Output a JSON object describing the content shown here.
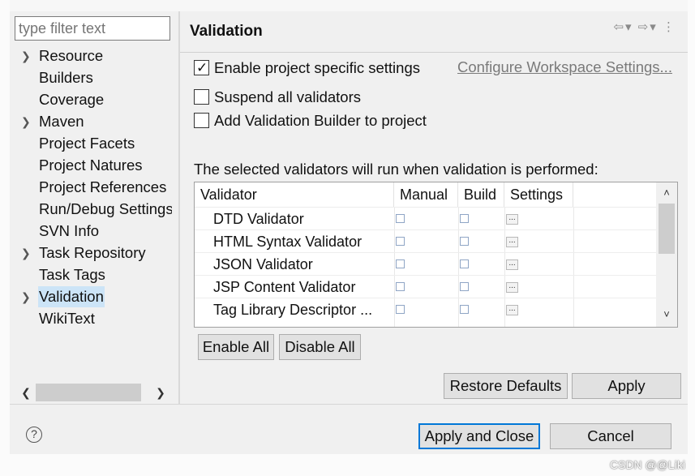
{
  "filter": {
    "placeholder": "type filter text"
  },
  "tree": [
    {
      "label": "Resource",
      "expandable": true
    },
    {
      "label": "Builders",
      "expandable": false
    },
    {
      "label": "Coverage",
      "expandable": false
    },
    {
      "label": "Maven",
      "expandable": true
    },
    {
      "label": "Project Facets",
      "expandable": false
    },
    {
      "label": "Project Natures",
      "expandable": false
    },
    {
      "label": "Project References",
      "expandable": false
    },
    {
      "label": "Run/Debug Settings",
      "expandable": false
    },
    {
      "label": "SVN Info",
      "expandable": false
    },
    {
      "label": "Task Repository",
      "expandable": true
    },
    {
      "label": "Task Tags",
      "expandable": false
    },
    {
      "label": "Validation",
      "expandable": true,
      "selected": true
    },
    {
      "label": "WikiText",
      "expandable": false
    }
  ],
  "page": {
    "title": "Validation",
    "enable_specific": {
      "label": "Enable project specific settings",
      "checked": true
    },
    "configure_link": "Configure Workspace Settings...",
    "suspend": {
      "label": "Suspend all validators",
      "checked": false
    },
    "add_builder": {
      "label": "Add Validation Builder to project",
      "checked": false
    },
    "selected_label": "The selected validators will run when validation is performed:",
    "table": {
      "headers": {
        "validator": "Validator",
        "manual": "Manual",
        "build": "Build",
        "settings": "Settings"
      },
      "rows": [
        {
          "name": "DTD Validator",
          "manual": false,
          "build": false
        },
        {
          "name": "HTML Syntax Validator",
          "manual": false,
          "build": false
        },
        {
          "name": "JSON Validator",
          "manual": false,
          "build": false
        },
        {
          "name": "JSP Content Validator",
          "manual": false,
          "build": false
        },
        {
          "name": "Tag Library Descriptor ...",
          "manual": false,
          "build": false
        }
      ],
      "settings_glyph": "..."
    },
    "enable_all": "Enable All",
    "disable_all": "Disable All",
    "restore_defaults": "Restore Defaults",
    "apply": "Apply"
  },
  "footer": {
    "help": "?",
    "apply_close": "Apply and Close",
    "cancel": "Cancel"
  },
  "watermark": "CSDN @@Liki",
  "colors": {
    "selection": "#cce4f7",
    "default_button_border": "#0078d7",
    "link": "#7a7a7a"
  },
  "icons": [
    "expand-arrow-icon",
    "back-arrow-icon",
    "forward-arrow-icon",
    "view-menu-icon",
    "scroll-up-icon",
    "scroll-down-icon",
    "scroll-left-icon",
    "scroll-right-icon",
    "help-icon",
    "checkmark-icon"
  ]
}
